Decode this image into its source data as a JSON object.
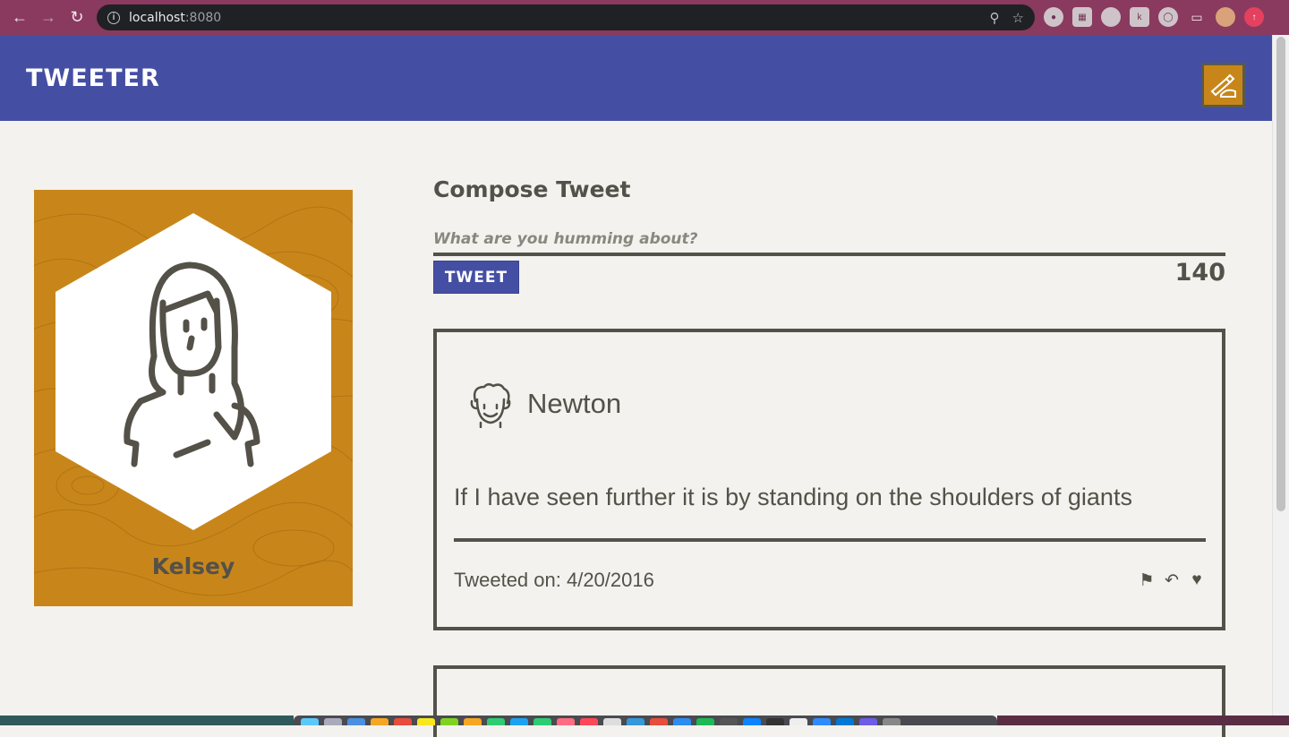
{
  "browser": {
    "url_host": "localhost",
    "url_port": ":8080",
    "nav_icons": [
      "back-icon",
      "forward-icon",
      "reload-icon"
    ],
    "omnibox_icons": [
      "zoom-icon",
      "star-icon"
    ]
  },
  "header": {
    "brand": "TWEETER",
    "compose_icon": "pen-hand-icon",
    "accent_color": "#444fa4"
  },
  "profile": {
    "name": "Kelsey",
    "card_color": "#c8861a"
  },
  "compose": {
    "title": "Compose Tweet",
    "placeholder": "What are you humming about?",
    "button_label": "TWEET",
    "counter": "140"
  },
  "tweets": [
    {
      "author": "Newton",
      "body": "If I have seen further it is by standing on the shoulders of giants",
      "date": "Tweeted on: 4/20/2016",
      "actions": [
        "flag-icon",
        "retweet-icon",
        "heart-icon"
      ]
    }
  ]
}
